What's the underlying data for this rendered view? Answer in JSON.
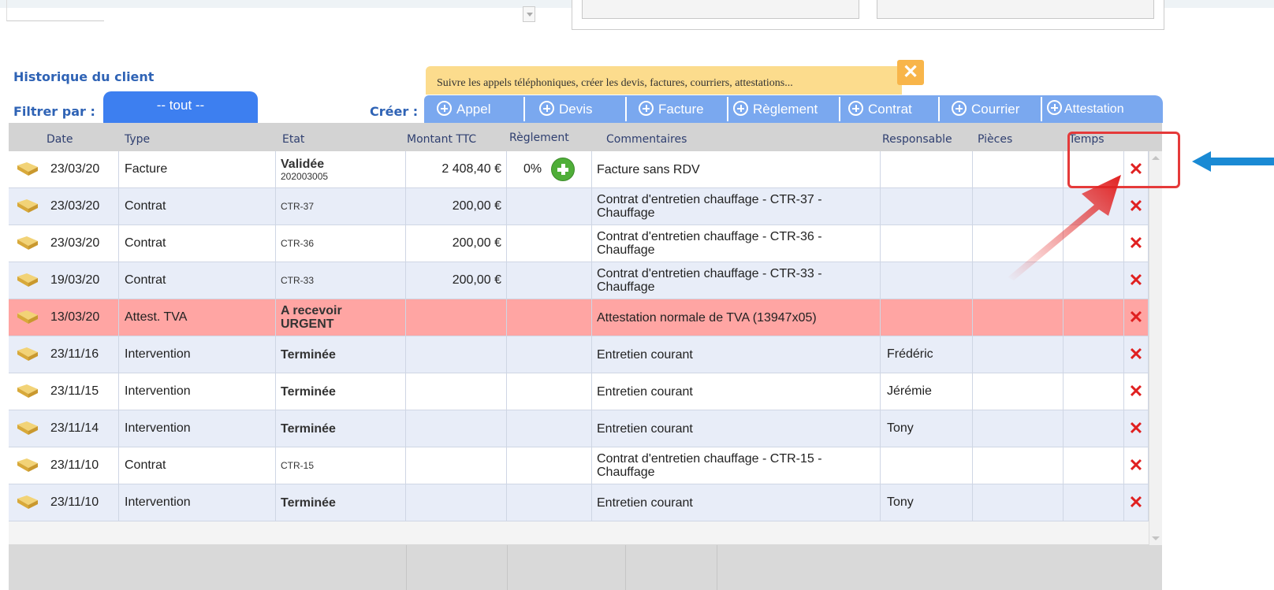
{
  "header": {
    "history_title": "Historique du client",
    "filter_label": "Filtrer par :",
    "filter_value": "-- tout --",
    "create_label": "Créer :",
    "tooltip_text": "Suivre les appels téléphoniques, créer les devis, factures, courriers, attestations...",
    "tooltip_close": "✕"
  },
  "create_buttons": [
    {
      "label": "Appel"
    },
    {
      "label": "Devis"
    },
    {
      "label": "Facture"
    },
    {
      "label": "Règlement"
    },
    {
      "label": "Contrat"
    },
    {
      "label": "Courrier"
    },
    {
      "label": "Attestation"
    }
  ],
  "table": {
    "columns": [
      "Date",
      "Type",
      "Etat",
      "Montant TTC",
      "Règlement",
      "Commentaires",
      "Responsable",
      "Pièces",
      "Temps"
    ],
    "rows": [
      {
        "date": "23/03/20",
        "type": "Facture",
        "etat": "Validée",
        "etat_sub": "202003005",
        "montant": "2 408,40 €",
        "reglement": "0%",
        "commentaire": "Facture sans RDV",
        "responsable": "",
        "style": "odd"
      },
      {
        "date": "23/03/20",
        "type": "Contrat",
        "etat": "",
        "etat_sub": "CTR-37",
        "montant": "200,00 €",
        "reglement": "",
        "commentaire": "Contrat d'entretien chauffage - CTR-37 - Chauffage",
        "responsable": "",
        "style": "even"
      },
      {
        "date": "23/03/20",
        "type": "Contrat",
        "etat": "",
        "etat_sub": "CTR-36",
        "montant": "200,00 €",
        "reglement": "",
        "commentaire": "Contrat d'entretien chauffage - CTR-36 - Chauffage",
        "responsable": "",
        "style": "odd"
      },
      {
        "date": "19/03/20",
        "type": "Contrat",
        "etat": "",
        "etat_sub": "CTR-33",
        "montant": "200,00 €",
        "reglement": "",
        "commentaire": "Contrat d'entretien chauffage - CTR-33 - Chauffage",
        "responsable": "",
        "style": "even"
      },
      {
        "date": "13/03/20",
        "type": "Attest. TVA",
        "etat": "A recevoir URGENT",
        "etat_sub": "",
        "montant": "",
        "reglement": "",
        "commentaire": "Attestation normale de TVA (13947x05)",
        "responsable": "",
        "style": "alert"
      },
      {
        "date": "23/11/16",
        "type": "Intervention",
        "etat": "Terminée",
        "etat_sub": "",
        "montant": "",
        "reglement": "",
        "commentaire": "Entretien courant",
        "responsable": "Frédéric",
        "style": "even"
      },
      {
        "date": "23/11/15",
        "type": "Intervention",
        "etat": "Terminée",
        "etat_sub": "",
        "montant": "",
        "reglement": "",
        "commentaire": "Entretien courant",
        "responsable": "Jérémie",
        "style": "odd"
      },
      {
        "date": "23/11/14",
        "type": "Intervention",
        "etat": "Terminée",
        "etat_sub": "",
        "montant": "",
        "reglement": "",
        "commentaire": "Entretien courant",
        "responsable": "Tony",
        "style": "even"
      },
      {
        "date": "23/11/10",
        "type": "Contrat",
        "etat": "",
        "etat_sub": "CTR-15",
        "montant": "",
        "reglement": "",
        "commentaire": "Contrat d'entretien chauffage - CTR-15 - Chauffage",
        "responsable": "",
        "style": "odd"
      },
      {
        "date": "23/11/10",
        "type": "Intervention",
        "etat": "Terminée",
        "etat_sub": "",
        "montant": "",
        "reglement": "",
        "commentaire": "Entretien courant",
        "responsable": "Tony",
        "style": "even"
      }
    ]
  },
  "icons": {
    "row_icon": "folder-icon",
    "delete_icon": "delete-x-icon",
    "delete_color": "#e02020",
    "add_payment_icon": "add-circle-icon",
    "annotation_arrow": "red-arrow-icon",
    "annotation_pointer": "blue-arrow-icon"
  },
  "colors": {
    "accent": "#3d7ff0",
    "create_bar": "#7aa8ef",
    "tooltip_bg": "#fcdc8d",
    "alert_row": "#ffa5a3",
    "highlight": "#e53a3a"
  }
}
